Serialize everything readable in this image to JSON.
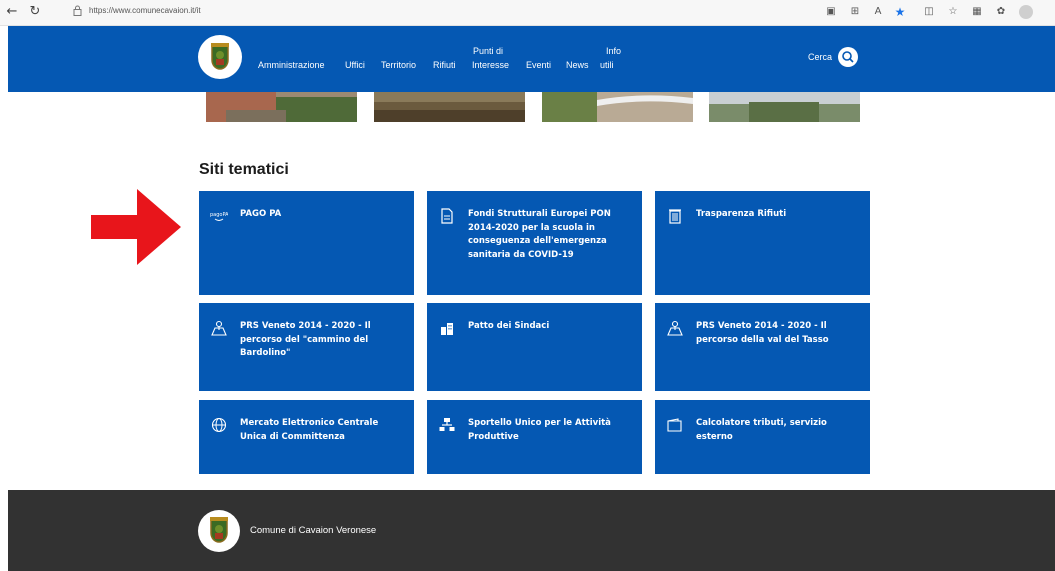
{
  "browser": {
    "url": "https://www.comunecavaion.it/it",
    "back_icon": "back-arrow-icon",
    "refresh_icon": "refresh-icon"
  },
  "header": {
    "nav": [
      {
        "label": "Amministrazione"
      },
      {
        "label": "Uffici"
      },
      {
        "label": "Territorio"
      },
      {
        "label": "Rifiuti"
      },
      {
        "label_top": "Punti di",
        "label": "Interesse"
      },
      {
        "label": "Eventi"
      },
      {
        "label": "News"
      },
      {
        "label_top": "Info",
        "label": "utili"
      }
    ],
    "search_label": "Cerca"
  },
  "section": {
    "title": "Siti tematici",
    "cards": [
      {
        "title": "PAGO PA",
        "icon": "pagopa-icon"
      },
      {
        "title": "Fondi Strutturali Europei PON 2014-2020 per la scuola in conseguenza dell'emergenza sanitaria da COVID-19",
        "icon": "document-icon"
      },
      {
        "title": "Trasparenza Rifiuti",
        "icon": "trash-bin-icon"
      },
      {
        "title": "PRS Veneto 2014 - 2020 - Il percorso del \"cammino del Bardolino\"",
        "icon": "map-pin-icon"
      },
      {
        "title": "Patto dei Sindaci",
        "icon": "buildings-icon"
      },
      {
        "title": "PRS Veneto 2014 - 2020 - Il percorso della val del Tasso",
        "icon": "map-pin-icon"
      },
      {
        "title": "Mercato Elettronico Centrale Unica di Committenza",
        "icon": "globe-icon"
      },
      {
        "title": "Sportello Unico per le Attività Produttive",
        "icon": "network-icon"
      },
      {
        "title": "Calcolatore tributi, servizio esterno",
        "icon": "wallet-icon"
      }
    ]
  },
  "footer": {
    "name": "Comune di Cavaion Veronese"
  },
  "colors": {
    "brand_blue": "#0558b3",
    "footer_dark": "#323232",
    "annotation_arrow": "#e8151b"
  }
}
